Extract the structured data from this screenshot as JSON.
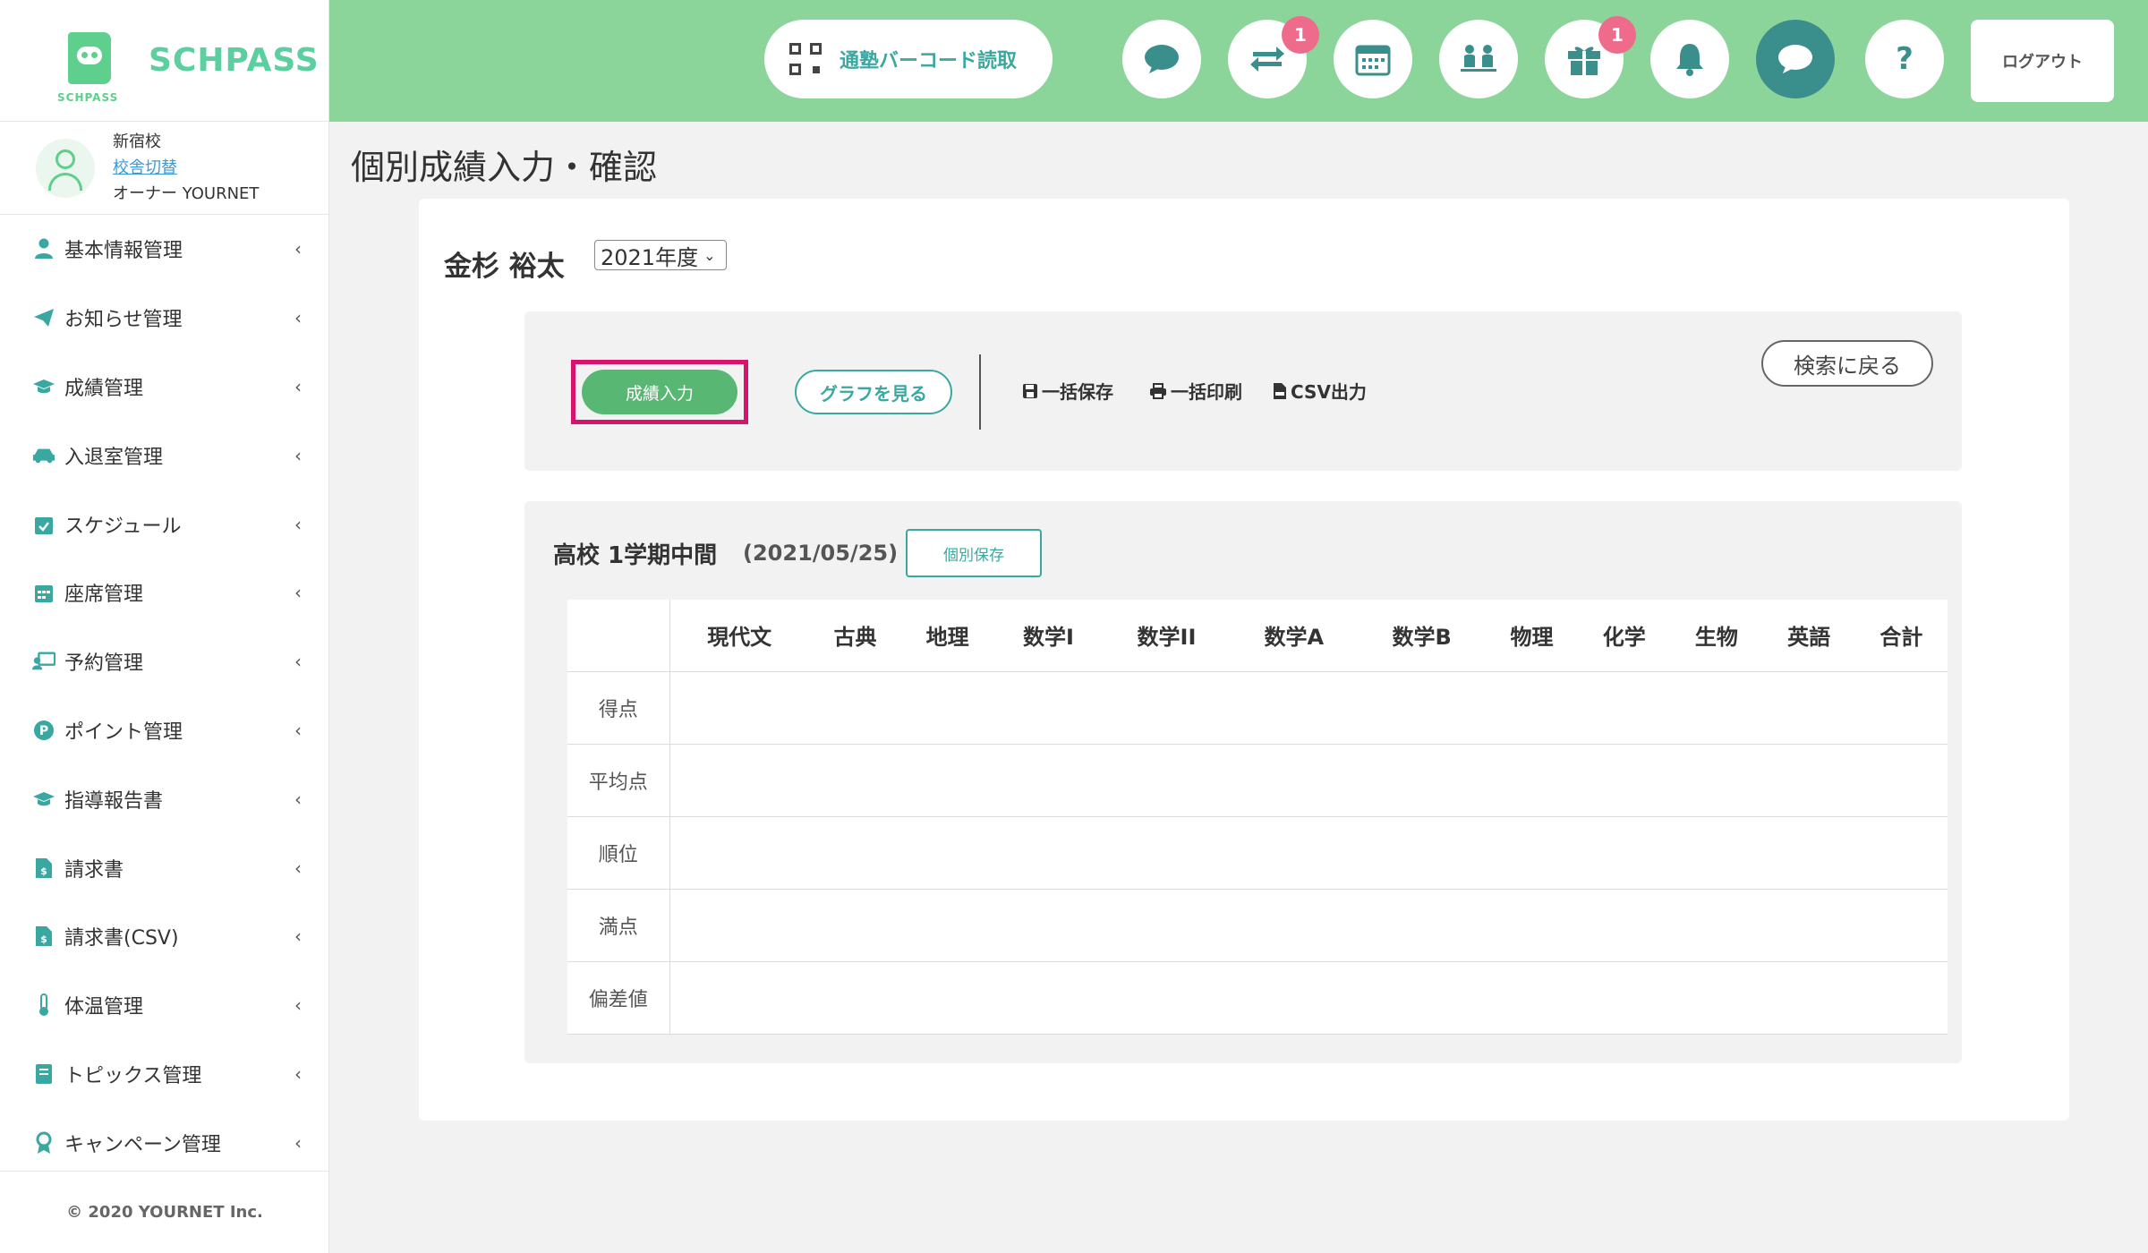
{
  "brand": {
    "name": "SCHPASS",
    "small": "SCHPASS"
  },
  "user": {
    "school": "新宿校",
    "switch_label": "校舎切替",
    "role": "オーナー YOURNET"
  },
  "sidebar": {
    "items": [
      {
        "label": "基本情報管理",
        "icon": "person-icon"
      },
      {
        "label": "お知らせ管理",
        "icon": "paper-plane-icon"
      },
      {
        "label": "成績管理",
        "icon": "graduation-cap-icon"
      },
      {
        "label": "入退室管理",
        "icon": "car-icon"
      },
      {
        "label": "スケジュール",
        "icon": "calendar-check-icon"
      },
      {
        "label": "座席管理",
        "icon": "grid-calendar-icon"
      },
      {
        "label": "予約管理",
        "icon": "teacher-board-icon"
      },
      {
        "label": "ポイント管理",
        "icon": "point-p-icon"
      },
      {
        "label": "指導報告書",
        "icon": "graduation-cap-icon"
      },
      {
        "label": "請求書",
        "icon": "invoice-icon"
      },
      {
        "label": "請求書(CSV)",
        "icon": "invoice-icon"
      },
      {
        "label": "体温管理",
        "icon": "thermometer-icon"
      },
      {
        "label": "トピックス管理",
        "icon": "book-icon"
      },
      {
        "label": "キャンペーン管理",
        "icon": "award-icon"
      }
    ],
    "footer": "© 2020 YOURNET Inc."
  },
  "header": {
    "barcode_label": "通塾バーコード読取",
    "icons": [
      {
        "name": "chat-icon",
        "badge": ""
      },
      {
        "name": "transfer-icon",
        "badge": "1"
      },
      {
        "name": "calendar-icon",
        "badge": ""
      },
      {
        "name": "meeting-icon",
        "badge": ""
      },
      {
        "name": "gift-icon",
        "badge": "1"
      },
      {
        "name": "bell-icon",
        "badge": ""
      },
      {
        "name": "message-icon",
        "badge": ""
      },
      {
        "name": "help-icon",
        "badge": ""
      }
    ],
    "logout_label": "ログアウト"
  },
  "page": {
    "title": "個別成績入力・確認",
    "student_name": "金杉 裕太",
    "year": "2021年度"
  },
  "actions": {
    "grade_input": "成績入力",
    "view_graph": "グラフを見る",
    "bulk_save": "一括保存",
    "bulk_print": "一括印刷",
    "csv_export": "CSV出力",
    "back_to_search": "検索に戻る"
  },
  "exam": {
    "title": "高校 1学期中間",
    "date": "(2021/05/25)",
    "save_label": "個別保存",
    "subjects": [
      "現代文",
      "古典",
      "地理",
      "数学I",
      "数学II",
      "数学A",
      "数学B",
      "物理",
      "化学",
      "生物",
      "英語",
      "合計"
    ],
    "rows": [
      "得点",
      "平均点",
      "順位",
      "満点",
      "偏差値"
    ]
  },
  "colors": {
    "header_bg": "#8cd59a",
    "accent": "#3aa8a0",
    "primary_button": "#58b873",
    "highlight": "#d6146b",
    "badge": "#ee6b8c"
  }
}
